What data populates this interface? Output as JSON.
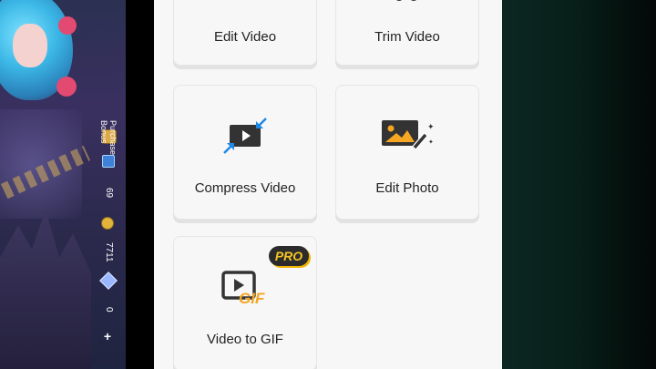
{
  "game": {
    "purchase_bonus": "Purchase Bonus",
    "tickets": "69",
    "gold": "7711",
    "diamonds": "0",
    "plus": "+"
  },
  "tools": [
    {
      "label": "Edit Video",
      "icon": "edit-video-icon"
    },
    {
      "label": "Trim Video",
      "icon": "trim-video-icon"
    },
    {
      "label": "Compress Video",
      "icon": "compress-video-icon"
    },
    {
      "label": "Edit Photo",
      "icon": "edit-photo-icon"
    },
    {
      "label": "Video to GIF",
      "icon": "video-to-gif-icon",
      "badge": "PRO"
    }
  ],
  "colors": {
    "accent_blue": "#1e88e5",
    "accent_orange": "#f5a623",
    "icon_dark": "#333333",
    "pro_gold": "#f6c325"
  }
}
